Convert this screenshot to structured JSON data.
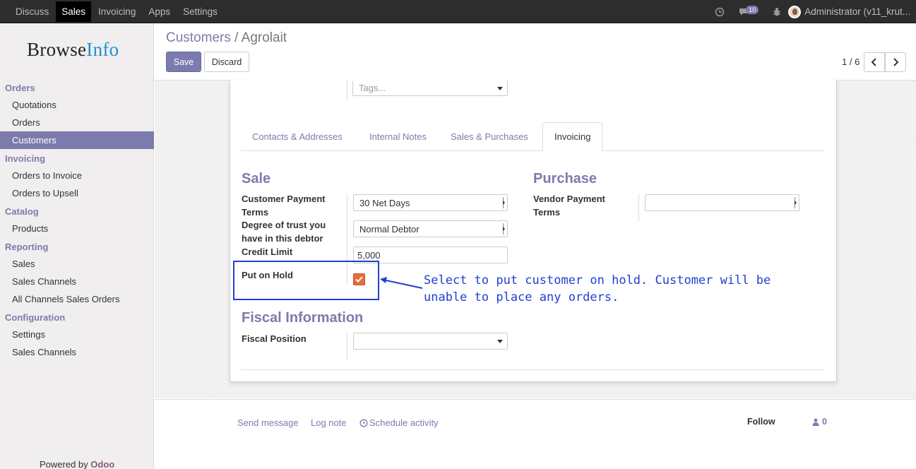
{
  "topbar": {
    "nav": [
      "Discuss",
      "Sales",
      "Invoicing",
      "Apps",
      "Settings"
    ],
    "active": "Sales",
    "messages_count": "10",
    "user": "Administrator (v11_krut..."
  },
  "sidebar": {
    "logo_browse": "Browse",
    "logo_info": "Info",
    "sections": [
      {
        "title": "Orders",
        "items": [
          "Quotations",
          "Orders",
          "Customers"
        ]
      },
      {
        "title": "Invoicing",
        "items": [
          "Orders to Invoice",
          "Orders to Upsell"
        ]
      },
      {
        "title": "Catalog",
        "items": [
          "Products"
        ]
      },
      {
        "title": "Reporting",
        "items": [
          "Sales",
          "Sales Channels",
          "All Channels Sales Orders"
        ]
      },
      {
        "title": "Configuration",
        "items": [
          "Settings",
          "Sales Channels"
        ]
      }
    ],
    "active_item": "Customers",
    "powered_by": "Powered by",
    "powered_brand": "Odoo"
  },
  "control": {
    "breadcrumb_parent": "Customers",
    "breadcrumb_sep": "/",
    "breadcrumb_current": "Agrolait",
    "save_label": "Save",
    "discard_label": "Discard",
    "pager": "1 / 6"
  },
  "form": {
    "tags_placeholder": "Tags...",
    "tabs": [
      "Contacts & Addresses",
      "Internal Notes",
      "Sales & Purchases",
      "Invoicing"
    ],
    "active_tab": "Invoicing",
    "sale_title": "Sale",
    "purchase_title": "Purchase",
    "customer_payment_terms_label_1": "Customer Payment",
    "customer_payment_terms_label_2": "Terms",
    "customer_payment_terms_value": "30 Net Days",
    "trust_label_1": "Degree of trust you",
    "trust_label_2": "have in this debtor",
    "trust_value": "Normal Debtor",
    "credit_limit_label": "Credit Limit",
    "credit_limit_value": "5,000",
    "put_on_hold_label": "Put on Hold",
    "put_on_hold_checked": true,
    "vendor_payment_terms_label_1": "Vendor Payment",
    "vendor_payment_terms_label_2": "Terms",
    "vendor_payment_terms_value": "",
    "fiscal_title": "Fiscal Information",
    "fiscal_position_label": "Fiscal Position",
    "fiscal_position_value": ""
  },
  "annotation": {
    "line1": "Select to put customer on hold. Customer will be",
    "line2": "unable to place any orders.",
    "color": "#1f3fd2"
  },
  "chatter": {
    "send_message": "Send message",
    "log_note": "Log note",
    "schedule_activity": "Schedule activity",
    "follow": "Follow",
    "followers_count": "0"
  },
  "colors": {
    "brand": "#7c7bad",
    "checkbox": "#e66d3a",
    "topbar": "#2d2d2d"
  }
}
